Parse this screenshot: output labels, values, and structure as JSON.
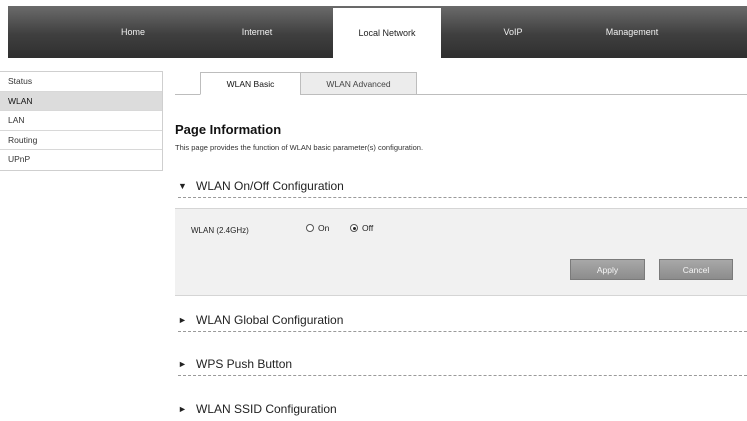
{
  "topnav": {
    "items": [
      {
        "label": "Home",
        "active": false
      },
      {
        "label": "Internet",
        "active": false
      },
      {
        "label": "Local Network",
        "active": true
      },
      {
        "label": "VoIP",
        "active": false
      },
      {
        "label": "Management",
        "active": false
      }
    ]
  },
  "sidebar": {
    "items": [
      {
        "label": "Status",
        "active": false
      },
      {
        "label": "WLAN",
        "active": true
      },
      {
        "label": "LAN",
        "active": false
      },
      {
        "label": "Routing",
        "active": false
      },
      {
        "label": "UPnP",
        "active": false
      }
    ]
  },
  "tabs": [
    {
      "label": "WLAN Basic",
      "active": true
    },
    {
      "label": "WLAN Advanced",
      "active": false
    }
  ],
  "page": {
    "title": "Page Information",
    "description": "This page provides the function of WLAN basic parameter(s) configuration."
  },
  "sections": {
    "onoff": {
      "title": "WLAN On/Off Configuration",
      "expanded": true
    },
    "global": {
      "title": "WLAN Global Configuration",
      "expanded": false
    },
    "wps": {
      "title": "WPS Push Button",
      "expanded": false
    },
    "ssid": {
      "title": "WLAN SSID Configuration",
      "expanded": false
    }
  },
  "onoff_panel": {
    "field_label": "WLAN (2.4GHz)",
    "options": [
      {
        "label": "On",
        "checked": false
      },
      {
        "label": "Off",
        "checked": true
      }
    ],
    "apply_label": "Apply",
    "cancel_label": "Cancel"
  }
}
